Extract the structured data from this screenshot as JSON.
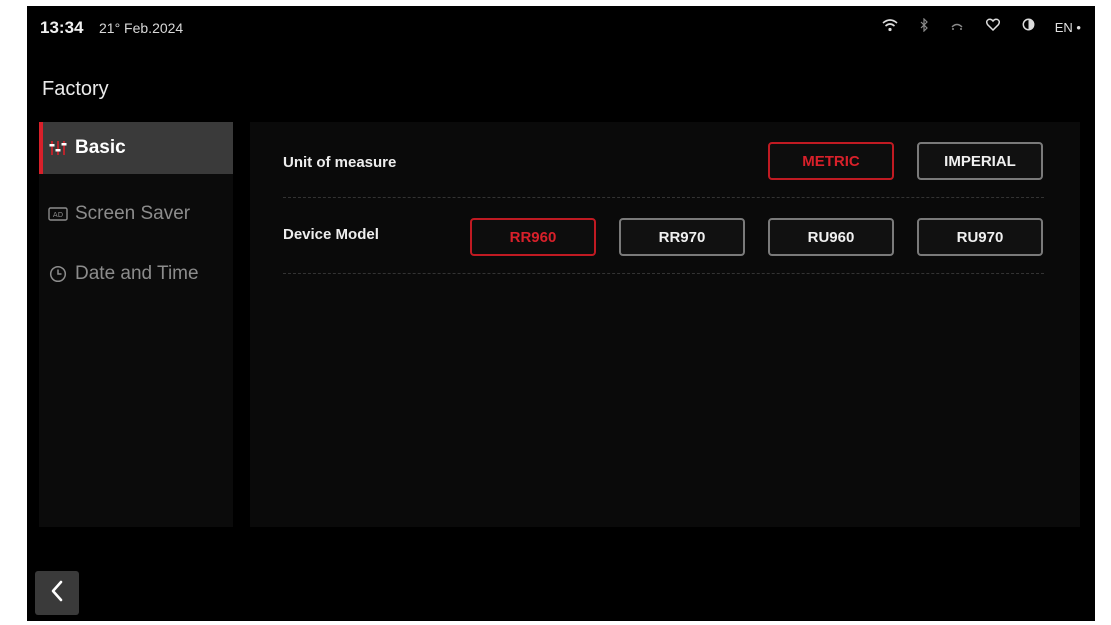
{
  "status_bar": {
    "time": "13:34",
    "date": "21° Feb.2024",
    "icons": [
      "wifi-icon",
      "bluetooth-icon",
      "signal-icon",
      "heart-icon",
      "contrast-icon"
    ],
    "language": "EN •"
  },
  "page": {
    "title": "Factory"
  },
  "sidebar": {
    "items": [
      {
        "label": "Basic",
        "icon": "sliders-icon",
        "active": true
      },
      {
        "label": "Screen Saver",
        "icon": "screen-saver-icon",
        "active": false
      },
      {
        "label": "Date and Time",
        "icon": "clock-icon",
        "active": false
      }
    ]
  },
  "settings": {
    "unit": {
      "label": "Unit of measure",
      "options": [
        "METRIC",
        "IMPERIAL"
      ],
      "selected": "METRIC"
    },
    "device": {
      "label": "Device Model",
      "options": [
        "RR960",
        "RR970",
        "RU960",
        "RU970"
      ],
      "selected": "RR960"
    }
  },
  "colors": {
    "accent": "#d8202a",
    "background": "#000000",
    "sidebar_active": "#3a3a3a"
  },
  "nav": {
    "back_icon": "chevron-left-icon"
  }
}
